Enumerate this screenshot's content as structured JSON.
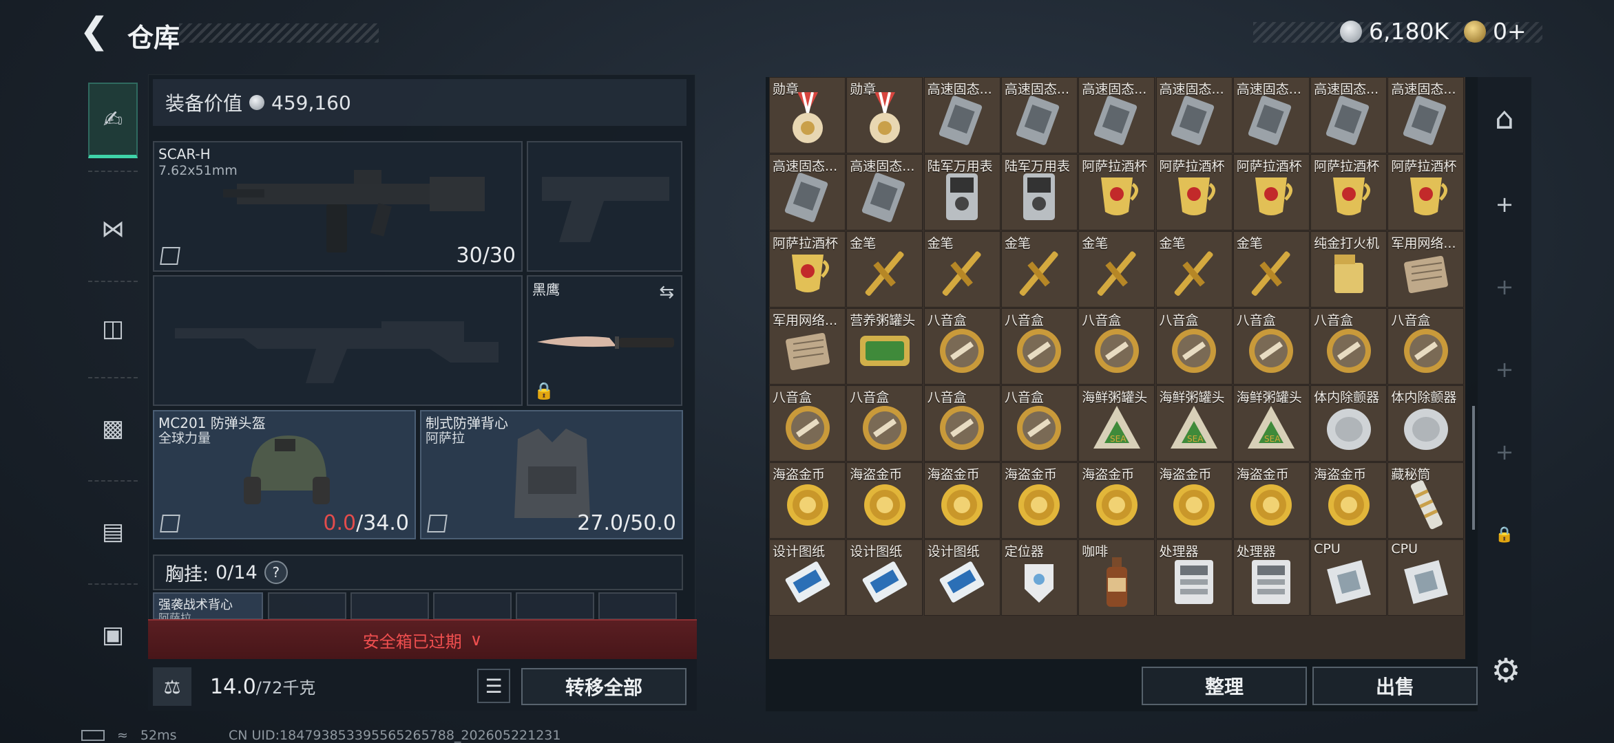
{
  "header": {
    "title": "仓库",
    "back_icon": "back-arrow-icon"
  },
  "currency": [
    {
      "icon": "silver-coin-icon",
      "value": "6,180K",
      "color": "#c9cfd6"
    },
    {
      "icon": "gold-coin-icon",
      "value": "0+",
      "color": "#d6a84a"
    }
  ],
  "nav": [
    {
      "icon": "pistol-icon",
      "active": true
    },
    {
      "icon": "vest-icon",
      "active": false
    },
    {
      "icon": "backpack-icon",
      "active": false
    },
    {
      "icon": "pouch-icon",
      "active": false
    },
    {
      "icon": "clipboard-icon",
      "active": false
    },
    {
      "icon": "briefcase-icon",
      "active": false
    }
  ],
  "equipment": {
    "value_label": "装备价值",
    "value": "459,160",
    "primary": {
      "name": "SCAR-H",
      "ammo": "7.62x51mm",
      "count": "30/30"
    },
    "melee": {
      "name": "黑鹰"
    },
    "helmet": {
      "name": "MC201 防弹头盔",
      "maker": "全球力量",
      "dur_current": "0.0",
      "dur_max": "/34.0"
    },
    "armor": {
      "name": "制式防弹背心",
      "maker": "阿萨拉",
      "durability": "27.0/50.0"
    },
    "chest_label": "胸挂:",
    "chest_count": "0/14",
    "chest_help": "?",
    "chest_item": "强袭战术背心",
    "chest_item_sub": "阿萨拉"
  },
  "safebox": {
    "text": "安全箱已过期"
  },
  "bottom": {
    "weight": "14.0",
    "weight_max": "/72千克",
    "transfer": "转移全部"
  },
  "grid": {
    "items": [
      "勋章",
      "勋章",
      "高速固态...",
      "高速固态...",
      "高速固态...",
      "高速固态...",
      "高速固态...",
      "高速固态...",
      "高速固态...",
      "高速固态...",
      "高速固态...",
      "陆军万用表",
      "陆军万用表",
      "阿萨拉酒杯",
      "阿萨拉酒杯",
      "阿萨拉酒杯",
      "阿萨拉酒杯",
      "阿萨拉酒杯",
      "阿萨拉酒杯",
      "金笔",
      "金笔",
      "金笔",
      "金笔",
      "金笔",
      "金笔",
      "纯金打火机",
      "军用网络...",
      "军用网络...",
      "营养粥罐头",
      "八音盒",
      "八音盒",
      "八音盒",
      "八音盒",
      "八音盒",
      "八音盒",
      "八音盒",
      "八音盒",
      "八音盒",
      "八音盒",
      "八音盒",
      "海鲜粥罐头",
      "海鲜粥罐头",
      "海鲜粥罐头",
      "体内除颤器",
      "体内除颤器",
      "海盗金币",
      "海盗金币",
      "海盗金币",
      "海盗金币",
      "海盗金币",
      "海盗金币",
      "海盗金币",
      "海盗金币",
      "藏秘筒",
      "设计图纸",
      "设计图纸",
      "设计图纸",
      "定位器",
      "咖啡",
      "处理器",
      "处理器",
      "CPU",
      "CPU"
    ]
  },
  "actions": {
    "sort": "整理",
    "sell": "出售"
  },
  "status": {
    "ping": "52ms",
    "uid": "CN UID:1847938533955652657​88_202605221231"
  }
}
